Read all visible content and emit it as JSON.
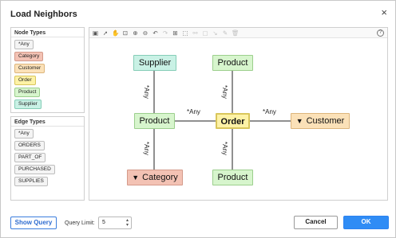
{
  "dialog": {
    "title": "Load Neighbors",
    "close_glyph": "×"
  },
  "node_types": {
    "header": "Node Types",
    "items": [
      {
        "label": "*Any",
        "color": "#f4f4f4",
        "border": "#bdbdbd"
      },
      {
        "label": "Category",
        "color": "#f3c2b4",
        "border": "#d49a8a"
      },
      {
        "label": "Customer",
        "color": "#fbe1b8",
        "border": "#ddb57c"
      },
      {
        "label": "Order",
        "color": "#fdf2a6",
        "border": "#d9c65c"
      },
      {
        "label": "Product",
        "color": "#d7f5cd",
        "border": "#9ccf8d"
      },
      {
        "label": "Supplier",
        "color": "#c9f1e5",
        "border": "#85cdb7"
      }
    ]
  },
  "edge_types": {
    "header": "Edge Types",
    "items": [
      {
        "label": "*Any"
      },
      {
        "label": "ORDERS"
      },
      {
        "label": "PART_OF"
      },
      {
        "label": "PURCHASED"
      },
      {
        "label": "SUPPLIES"
      }
    ]
  },
  "toolbar": {
    "icons": [
      {
        "name": "save-icon",
        "glyph": "▣",
        "enabled": true
      },
      {
        "name": "pointer-icon",
        "glyph": "➚",
        "enabled": true
      },
      {
        "name": "pan-hand-icon",
        "glyph": "✋",
        "enabled": true
      },
      {
        "name": "zoom-fit-icon",
        "glyph": "⊡",
        "enabled": true
      },
      {
        "name": "zoom-in-icon",
        "glyph": "⊕",
        "enabled": true
      },
      {
        "name": "zoom-out-icon",
        "glyph": "⊖",
        "enabled": true
      },
      {
        "name": "undo-icon",
        "glyph": "↶",
        "enabled": true
      },
      {
        "name": "redo-icon",
        "glyph": "↷",
        "enabled": false
      },
      {
        "name": "layout-icon",
        "glyph": "⊞",
        "enabled": true
      },
      {
        "name": "select-area-icon",
        "glyph": "⬚",
        "enabled": true
      },
      {
        "name": "link-icon",
        "glyph": "⚯",
        "enabled": false
      },
      {
        "name": "edit-node-icon",
        "glyph": "▢",
        "enabled": false
      },
      {
        "name": "edge-tool-icon",
        "glyph": "↘",
        "enabled": false
      },
      {
        "name": "pencil-icon",
        "glyph": "✎",
        "enabled": false
      },
      {
        "name": "trash-icon",
        "glyph": "🗑",
        "enabled": false
      }
    ],
    "help_glyph": "?"
  },
  "graph": {
    "nodes": {
      "supplier": {
        "label": "Supplier",
        "color": "#c9f1e5",
        "border": "#85cdb7"
      },
      "product_top": {
        "label": "Product",
        "color": "#d7f5cd",
        "border": "#9ccf8d"
      },
      "product_left": {
        "label": "Product",
        "color": "#d7f5cd",
        "border": "#9ccf8d"
      },
      "order": {
        "label": "Order",
        "color": "#fdf2a6",
        "border": "#d9c65c"
      },
      "customer": {
        "label": "Customer",
        "color": "#fbe1b8",
        "border": "#ddb57c",
        "icon": "filter-icon"
      },
      "category": {
        "label": "Category",
        "color": "#f3c2b4",
        "border": "#d49a8a",
        "icon": "filter-icon"
      },
      "product_bottom": {
        "label": "Product",
        "color": "#d7f5cd",
        "border": "#9ccf8d"
      }
    },
    "edge_labels": {
      "supplier_product": "*Any",
      "product_top_order": "*Any",
      "product_order": "*Any",
      "order_customer": "*Any",
      "product_category": "*Any",
      "order_product_bottom": "*Any"
    }
  },
  "footer": {
    "show_query": "Show Query",
    "query_limit_label": "Query Limit:",
    "query_limit_value": "5",
    "cancel": "Cancel",
    "ok": "OK"
  }
}
